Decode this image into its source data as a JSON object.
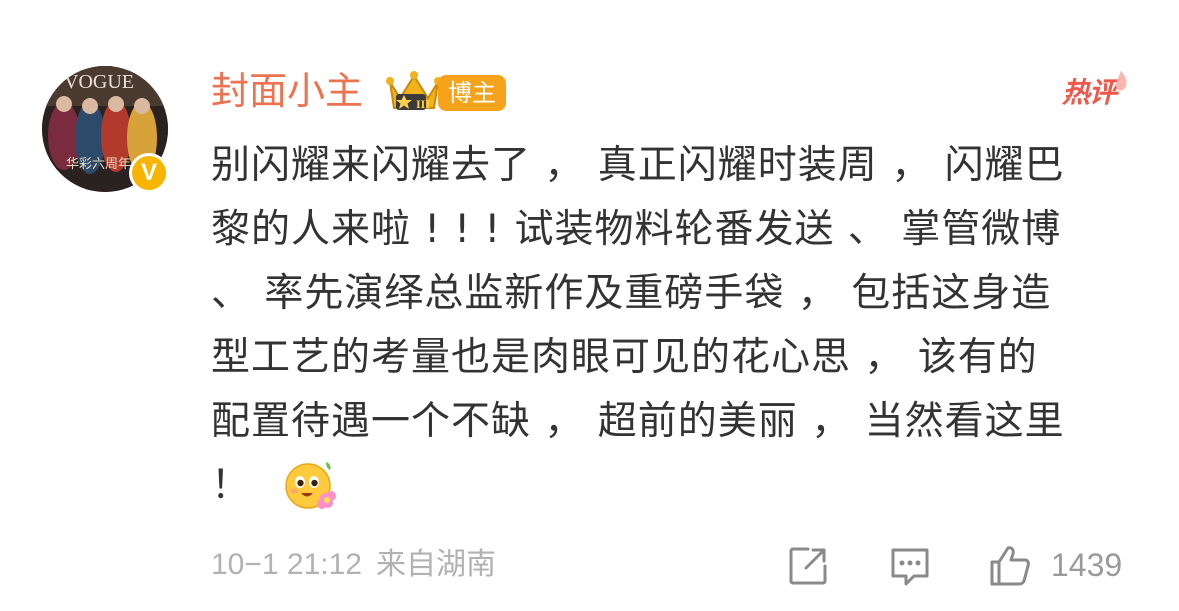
{
  "comment": {
    "username": "封面小主",
    "crown_level": "III",
    "blogger_tag": "博主",
    "hot_tag": "热评",
    "verified_mark": "V",
    "avatar_text": {
      "brand": "VOGUE",
      "caption": "华彩六周年"
    },
    "content_lines": [
      "别闪耀来闪耀去了 ， 真正闪耀时装周 ， 闪耀巴",
      "黎的人来啦 ! ! !  试装物料轮番发送 、 掌管微博",
      "、 率先演绎总监新作及重磅手袋 ， 包括这身造",
      "型工艺的考量也是肉眼可见的花心思 ， 该有的",
      "配置待遇一个不缺 ， 超前的美丽 ， 当然看这里",
      "！"
    ],
    "emoji_name": "flower-face-emoji",
    "timestamp": "10−1 21:12",
    "source": "来自湖南",
    "like_count": "1439"
  },
  "colors": {
    "username": "#eb7350",
    "blogger_tag_bg": "#f6a21a",
    "hot_tag": "#f0574a",
    "verified_badge": "#f7b500",
    "body_text": "#333333",
    "meta_text": "#b2b2b2"
  },
  "icons": {
    "share": "share-icon",
    "comment": "comment-icon",
    "like": "like-icon",
    "crown": "crown-icon",
    "verified": "verified-badge-icon"
  }
}
